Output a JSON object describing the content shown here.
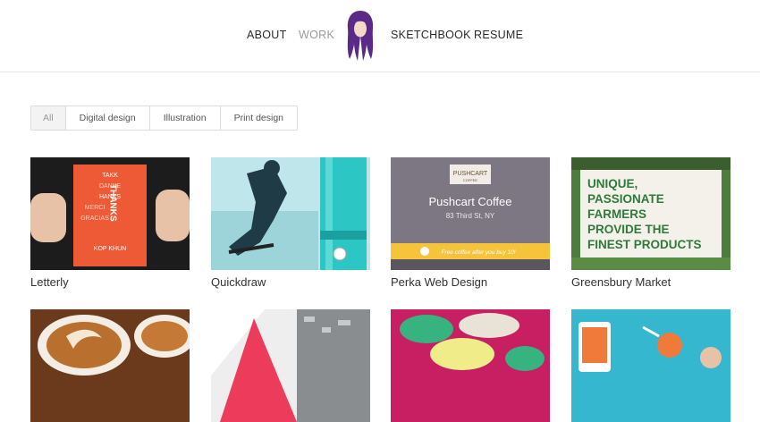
{
  "nav": {
    "left": [
      "ABOUT",
      "WORK"
    ],
    "right": [
      "SKETCHBOOK",
      "RESUME"
    ],
    "active": "WORK"
  },
  "logo": {
    "icon": "purple-hair-avatar-icon",
    "color": "#5b2a86"
  },
  "filters": [
    "All",
    "Digital design",
    "Illustration",
    "Print design"
  ],
  "projects": [
    {
      "title": "Letterly",
      "thumb_text": {
        "words_top": "TAKK",
        "words_mid": [
          "DANKE",
          "HANKS",
          "MERCI",
          "GRACIAS"
        ],
        "word_bottom": "KOP KHUN",
        "big": "THANKS"
      }
    },
    {
      "title": "Quickdraw"
    },
    {
      "title": "Perka Web Design",
      "thumb_text": {
        "sign_top": "PUSHCART",
        "sign_bottom": "COFFEE",
        "headline": "Pushcart Coffee",
        "address": "83 Third St, NY",
        "banner": "Free coffee after you buy 10!"
      }
    },
    {
      "title": "Greensbury Market",
      "thumb_text": {
        "lines": [
          "UNIQUE,",
          "PASSIONATE",
          "FARMERS",
          "PROVIDE THE",
          "FINEST PRODUCTS"
        ]
      }
    },
    {
      "title": ""
    },
    {
      "title": ""
    },
    {
      "title": ""
    },
    {
      "title": ""
    }
  ],
  "colors": {
    "accent_purple": "#5b2a86",
    "letterly_orange": "#ef5a36",
    "quickdraw_teal": "#2cc6c4",
    "pushcart_yellow": "#f5c43a",
    "greensbury_green": "#2f7a3a"
  }
}
